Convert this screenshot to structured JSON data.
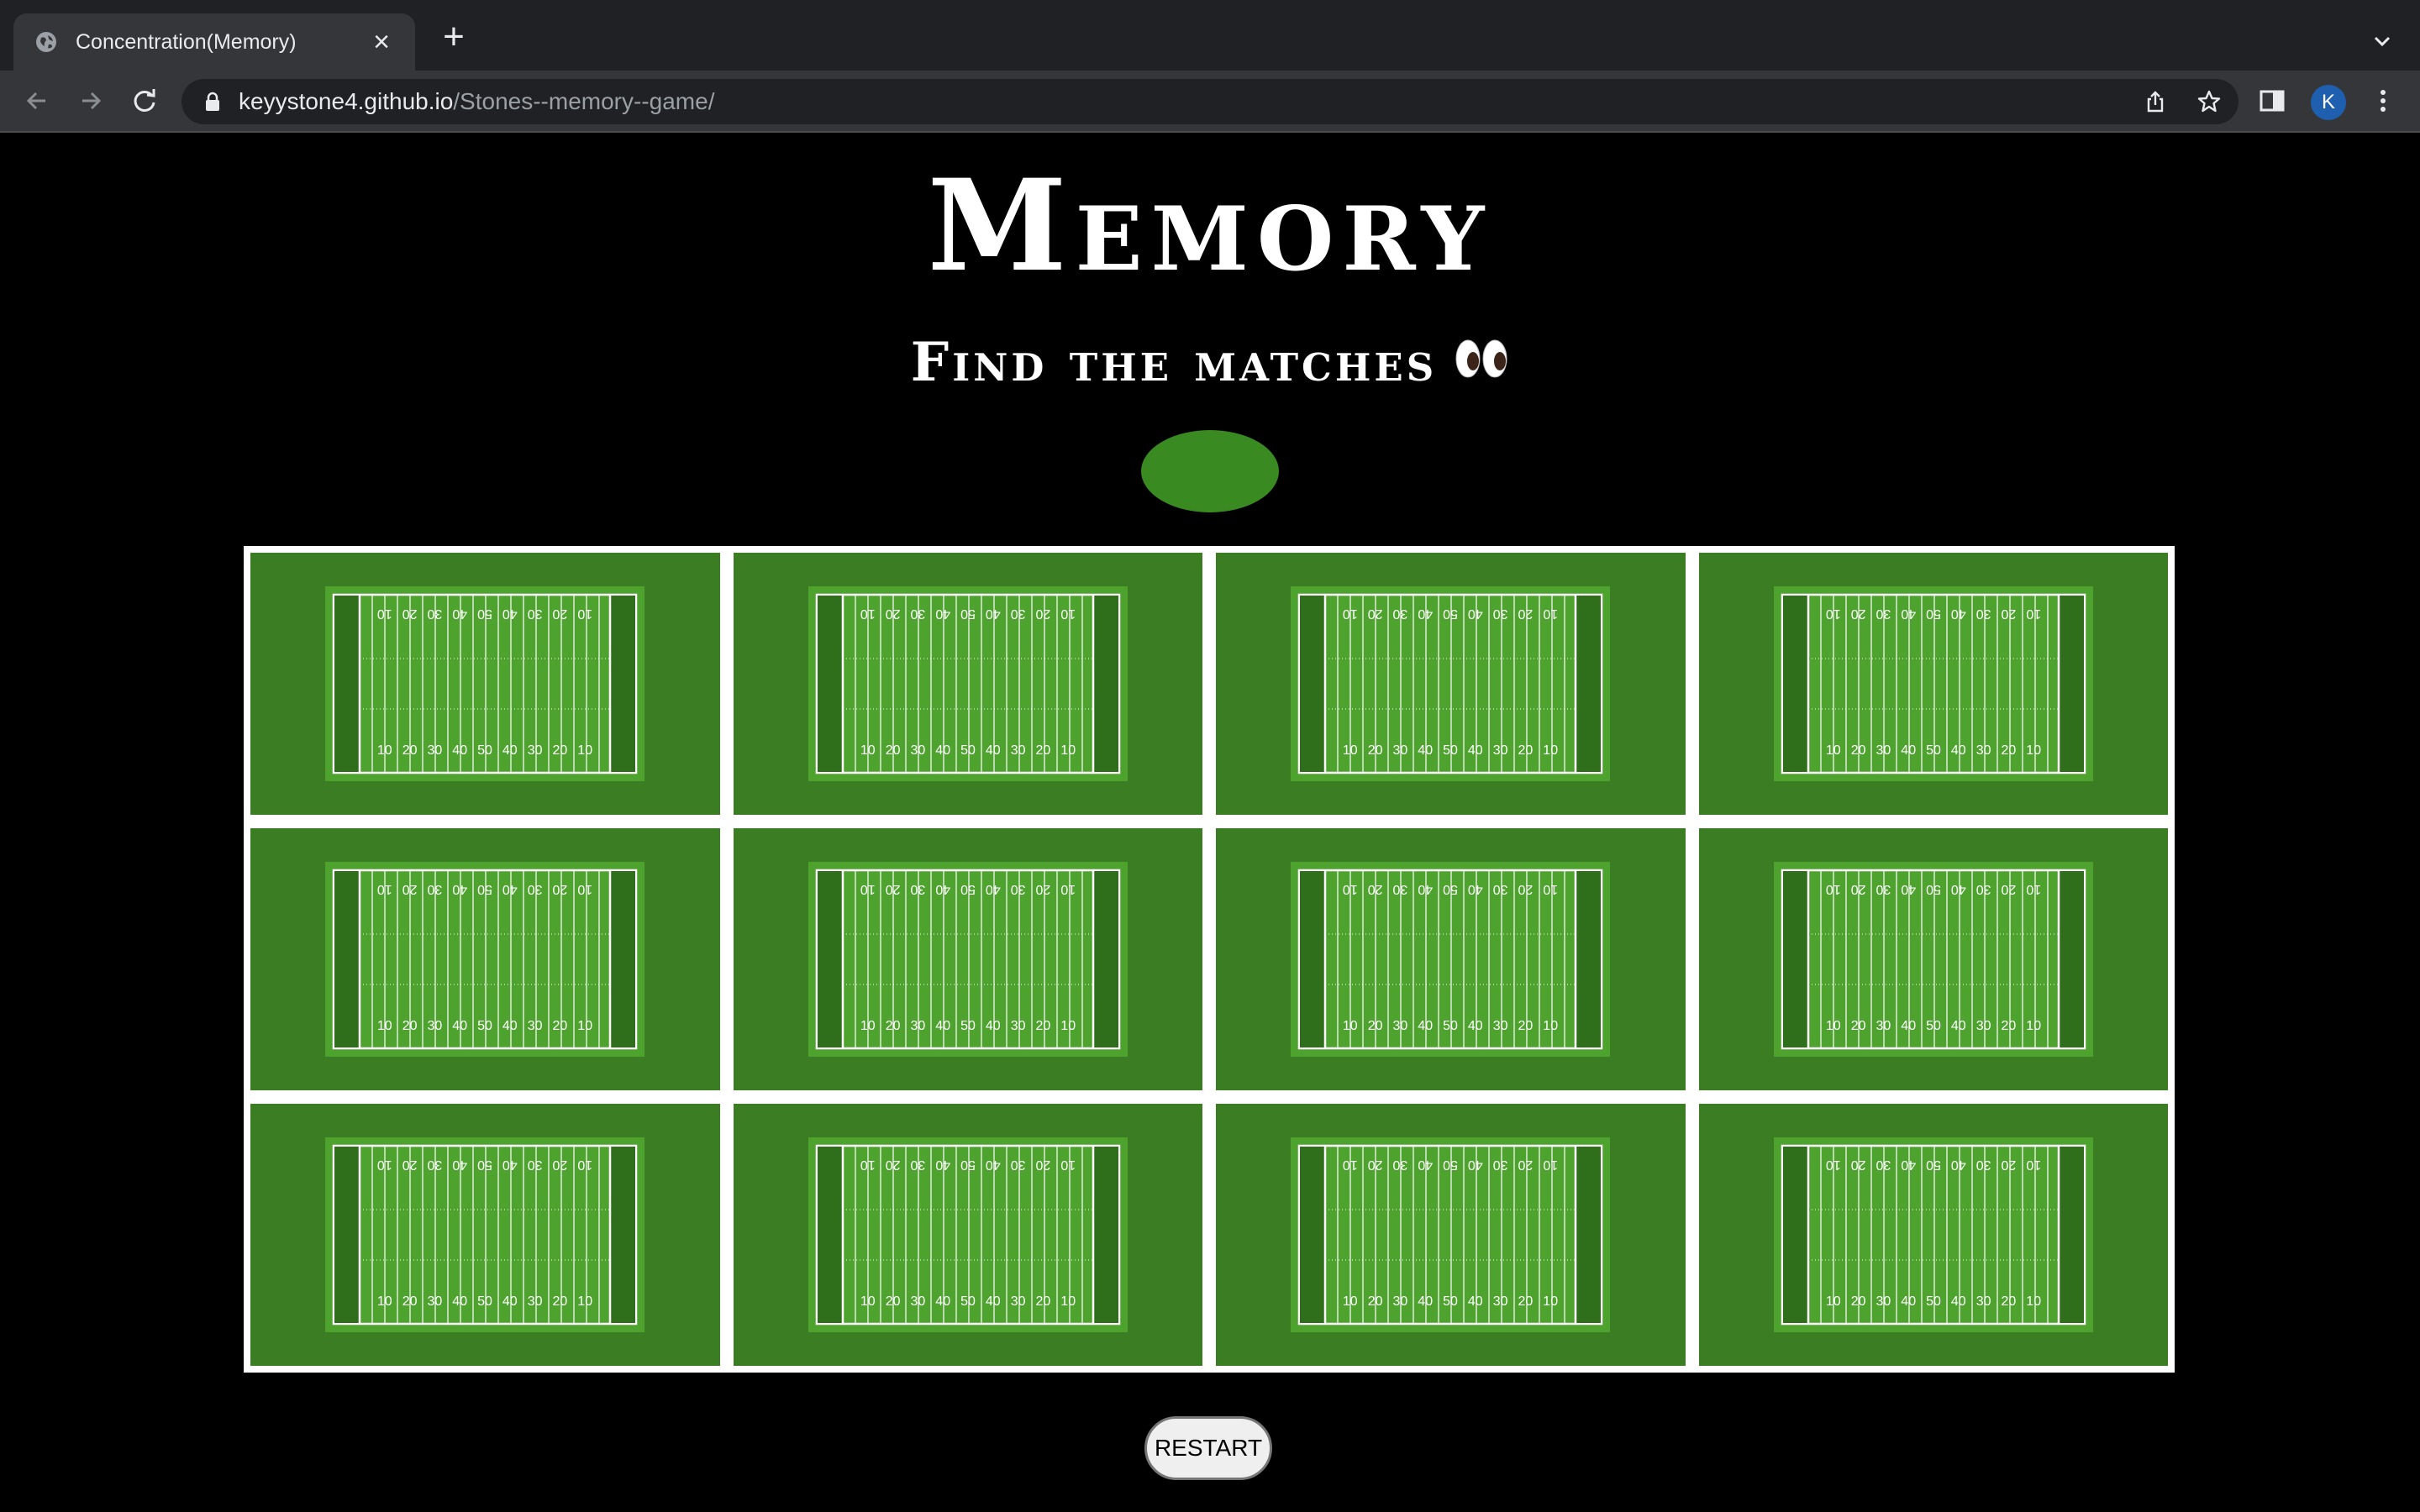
{
  "browser": {
    "tab_title": "Concentration(Memory)",
    "tab_close": "×",
    "new_tab": "+",
    "url_host": "keyystone4.github.io",
    "url_path": "/Stones--memory--game/",
    "avatar_initial": "K"
  },
  "game": {
    "title": "Memory",
    "subtitle": "Find the matches",
    "subtitle_emoji": "eyes",
    "restart_label": "RESTART",
    "rows": 3,
    "columns": 4,
    "card_back": "football-field",
    "field_numbers": [
      "10",
      "20",
      "30",
      "40",
      "50",
      "40",
      "30",
      "20",
      "10"
    ]
  },
  "colors": {
    "card_green": "#3a7d22",
    "field_green": "#4ea32e",
    "oval_green": "#3a8a22",
    "board_border": "#ffffff",
    "page_background": "#000000"
  }
}
